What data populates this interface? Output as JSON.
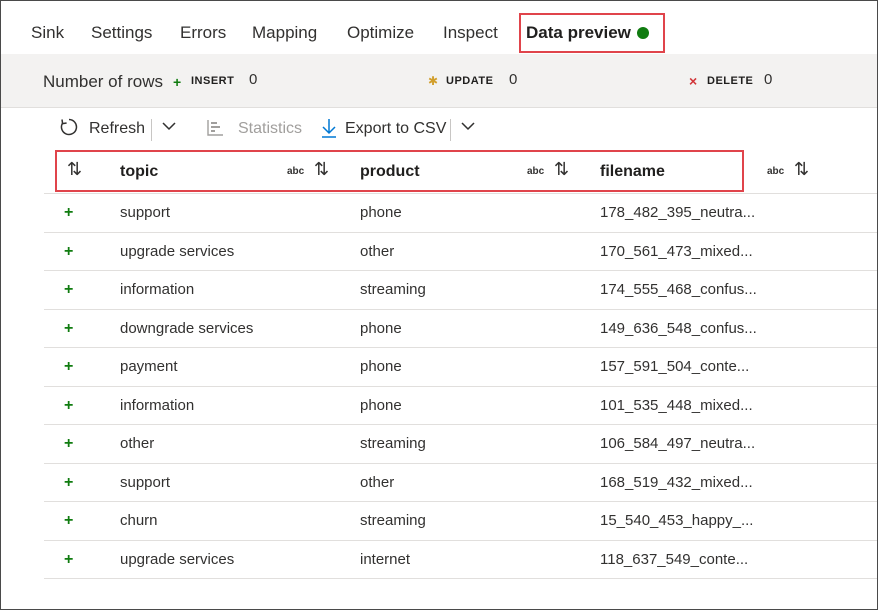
{
  "tabs": [
    {
      "label": "Sink"
    },
    {
      "label": "Settings"
    },
    {
      "label": "Errors"
    },
    {
      "label": "Mapping"
    },
    {
      "label": "Optimize"
    },
    {
      "label": "Inspect"
    },
    {
      "label": "Data preview",
      "active": true
    }
  ],
  "status_color": "#107c10",
  "summary": {
    "rows_label": "Number of rows",
    "insert_label": "INSERT",
    "insert_count": "0",
    "update_label": "UPDATE",
    "update_count": "0",
    "delete_label": "DELETE",
    "delete_count": "0"
  },
  "toolbar": {
    "refresh_label": "Refresh",
    "statistics_label": "Statistics",
    "export_label": "Export to CSV"
  },
  "columns": [
    {
      "label": "topic",
      "type_badge": "abc"
    },
    {
      "label": "product",
      "type_badge": "abc"
    },
    {
      "label": "filename",
      "type_badge": "abc"
    }
  ],
  "rows": [
    {
      "topic": "support",
      "product": "phone",
      "filename": "178_482_395_neutra..."
    },
    {
      "topic": "upgrade services",
      "product": "other",
      "filename": "170_561_473_mixed..."
    },
    {
      "topic": "information",
      "product": "streaming",
      "filename": "174_555_468_confus..."
    },
    {
      "topic": "downgrade services",
      "product": "phone",
      "filename": "149_636_548_confus..."
    },
    {
      "topic": "payment",
      "product": "phone",
      "filename": "157_591_504_conte..."
    },
    {
      "topic": "information",
      "product": "phone",
      "filename": "101_535_448_mixed..."
    },
    {
      "topic": "other",
      "product": "streaming",
      "filename": "106_584_497_neutra..."
    },
    {
      "topic": "support",
      "product": "other",
      "filename": "168_519_432_mixed..."
    },
    {
      "topic": "churn",
      "product": "streaming",
      "filename": "15_540_453_happy_..."
    },
    {
      "topic": "upgrade services",
      "product": "internet",
      "filename": "118_637_549_conte..."
    }
  ]
}
